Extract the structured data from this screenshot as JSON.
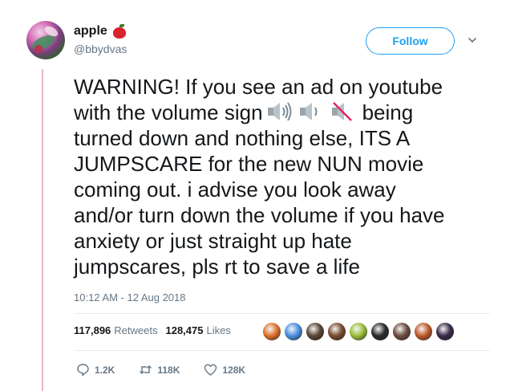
{
  "user": {
    "display_name": "apple",
    "handle": "@bbydvas",
    "name_icon": "red-apple-icon"
  },
  "follow_label": "Follow",
  "tweet": {
    "lines": [
      "WARNING! If you see an ad on youtube",
      "with the volume sign",
      "being",
      "turned down and nothing else, ITS A",
      "JUMPSCARE for the new NUN movie",
      "coming out. i advise you look away",
      "and/or turn down the volume if you have",
      "anxiety or just straight up hate",
      "jumpscares, pls rt to save a life"
    ],
    "emoji_icons": [
      "speaker-high-volume-icon",
      "speaker-low-volume-icon",
      "speaker-muted-icon"
    ]
  },
  "timestamp": "10:12 AM - 12 Aug 2018",
  "stats": {
    "retweets_count": "117,896",
    "retweets_label": "Retweets",
    "likes_count": "128,475",
    "likes_label": "Likes"
  },
  "liker_colors": [
    "#e0702a",
    "#4a90e2",
    "#5a4636",
    "#7a4a2e",
    "#9bbf3a",
    "#2b2b2b",
    "#6d4c41",
    "#c05a2a",
    "#3a2a4a"
  ],
  "actions": {
    "reply_count": "1.2K",
    "retweet_count": "118K",
    "like_count": "128K"
  },
  "colors": {
    "accent": "#1da1f2",
    "text": "#14171a",
    "muted": "#657786",
    "thread_line": "#e8b9cf"
  }
}
